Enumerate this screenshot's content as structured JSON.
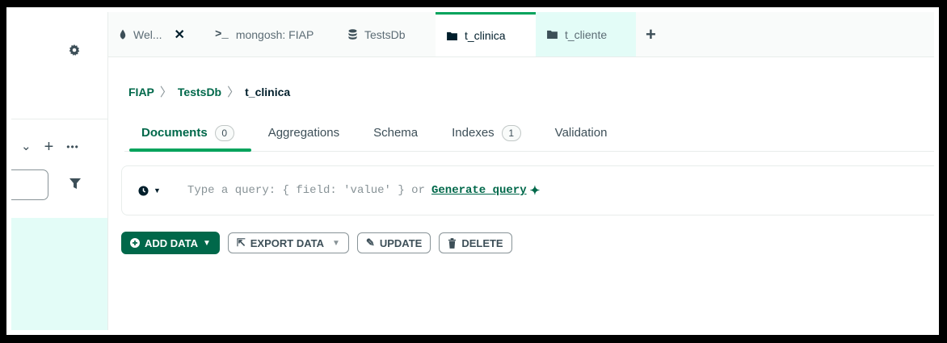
{
  "tabs": [
    {
      "label": "Wel...",
      "icon": "leaf-icon",
      "closable": true
    },
    {
      "label": "mongosh: FIAP",
      "icon": "terminal-icon"
    },
    {
      "label": "TestsDb",
      "icon": "database-icon"
    },
    {
      "label": "t_clinica",
      "icon": "folder-icon",
      "active": true
    },
    {
      "label": "t_cliente",
      "icon": "folder-icon"
    }
  ],
  "breadcrumb": {
    "cluster": "FIAP",
    "db": "TestsDb",
    "collection": "t_clinica"
  },
  "subtabs": {
    "documents": {
      "label": "Documents",
      "count": "0"
    },
    "aggregations": {
      "label": "Aggregations"
    },
    "schema": {
      "label": "Schema"
    },
    "indexes": {
      "label": "Indexes",
      "count": "1"
    },
    "validation": {
      "label": "Validation"
    }
  },
  "query": {
    "placeholder": "Type a query: { field: 'value' } or",
    "generate_link": "Generate query"
  },
  "actions": {
    "add_data": "ADD DATA",
    "export_data": "EXPORT DATA",
    "update": "UPDATE",
    "delete": "DELETE"
  },
  "colors": {
    "accent": "#00684a",
    "active_tab_bar": "#00a35c",
    "mint": "#e3fcf7"
  }
}
